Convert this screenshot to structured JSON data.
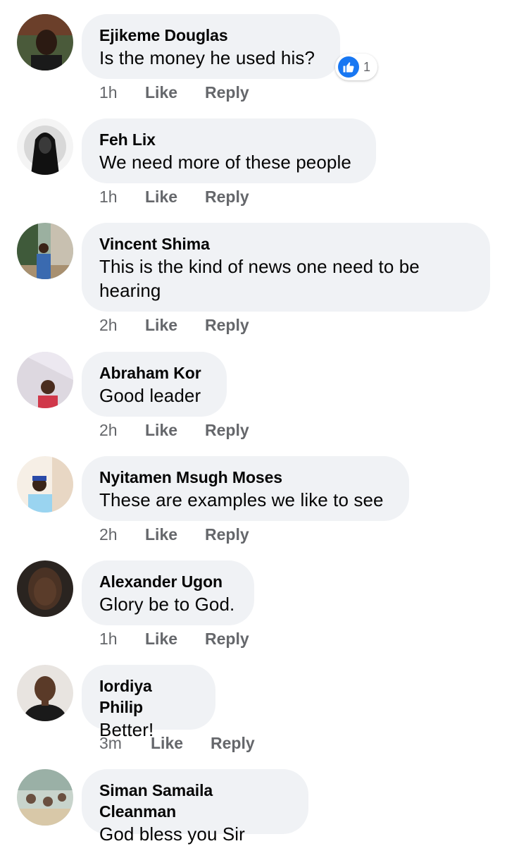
{
  "colors": {
    "bubble": "#f0f2f5",
    "meta": "#65676b",
    "like_blue": "#1877f2"
  },
  "actions": {
    "like": "Like",
    "reply": "Reply"
  },
  "comments": [
    {
      "author": "Ejikeme Douglas",
      "text": "Is the money he used his?",
      "time": "1h",
      "reaction_icon": "like-icon",
      "reactions": "1"
    },
    {
      "author": "Feh Lix",
      "text": "We need more of these people",
      "time": "1h"
    },
    {
      "author": "Vincent Shima",
      "text": "This is the kind of news one need to be hearing",
      "time": "2h"
    },
    {
      "author": "Abraham Kor",
      "text": "Good leader",
      "time": "2h"
    },
    {
      "author": "Nyitamen Msugh Moses",
      "text": "These are examples we like to see",
      "time": "2h"
    },
    {
      "author": "Alexander Ugon",
      "text": "Glory be to God.",
      "time": "1h"
    },
    {
      "author": "Iordiya Philip",
      "text": "Better!",
      "time": "3m"
    },
    {
      "author": "Siman Samaila Cleanman",
      "text": "God bless you Sir"
    }
  ]
}
